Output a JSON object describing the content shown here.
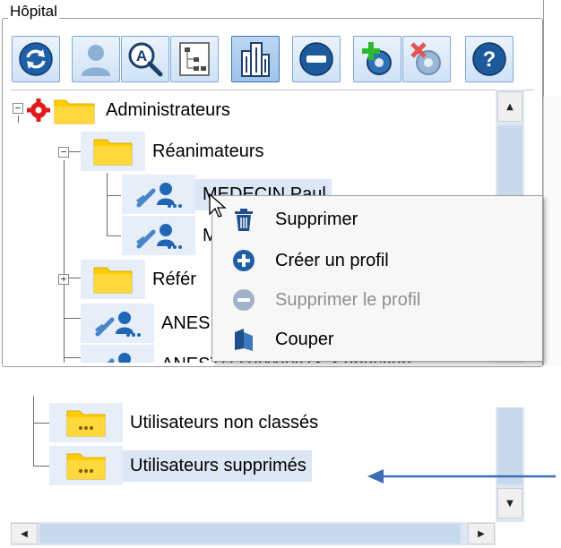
{
  "group_title": "Hôpital",
  "toolbar": {
    "buttons": [
      {
        "icon": "refresh-icon"
      },
      {
        "icon": "user-icon"
      },
      {
        "icon": "search-user-icon"
      },
      {
        "icon": "tree-view-icon"
      },
      {
        "icon": "building-icon",
        "pressed": true
      },
      {
        "icon": "minus-circle-icon"
      },
      {
        "icon": "add-gear-icon"
      },
      {
        "icon": "remove-gear-icon"
      },
      {
        "icon": "help-icon"
      }
    ]
  },
  "tree": {
    "root": "Administrateurs",
    "reanimateurs": "Réanimateurs",
    "medecin": "MEDECIN Paul",
    "second_user": "M",
    "referents": "Référ",
    "anest1": "ANES",
    "anest2": "ANESTH HAMANTS Sébastien",
    "non_classes": "Utilisateurs non classés",
    "supprimes": "Utilisateurs supprimés"
  },
  "context_menu": {
    "items": [
      {
        "label": "Supprimer",
        "icon": "trash-icon",
        "enabled": true
      },
      {
        "label": "Créer un profil",
        "icon": "plus-circle-icon",
        "enabled": true
      },
      {
        "label": "Supprimer le profil",
        "icon": "minus-circle-icon",
        "enabled": false
      },
      {
        "label": "Couper",
        "icon": "cut-icon",
        "enabled": true
      }
    ]
  },
  "colors": {
    "accent_blue": "#1f66b4",
    "folder_yellow": "#ffd200",
    "selection": "#dbe7f5",
    "arrow": "#3d6db5"
  }
}
